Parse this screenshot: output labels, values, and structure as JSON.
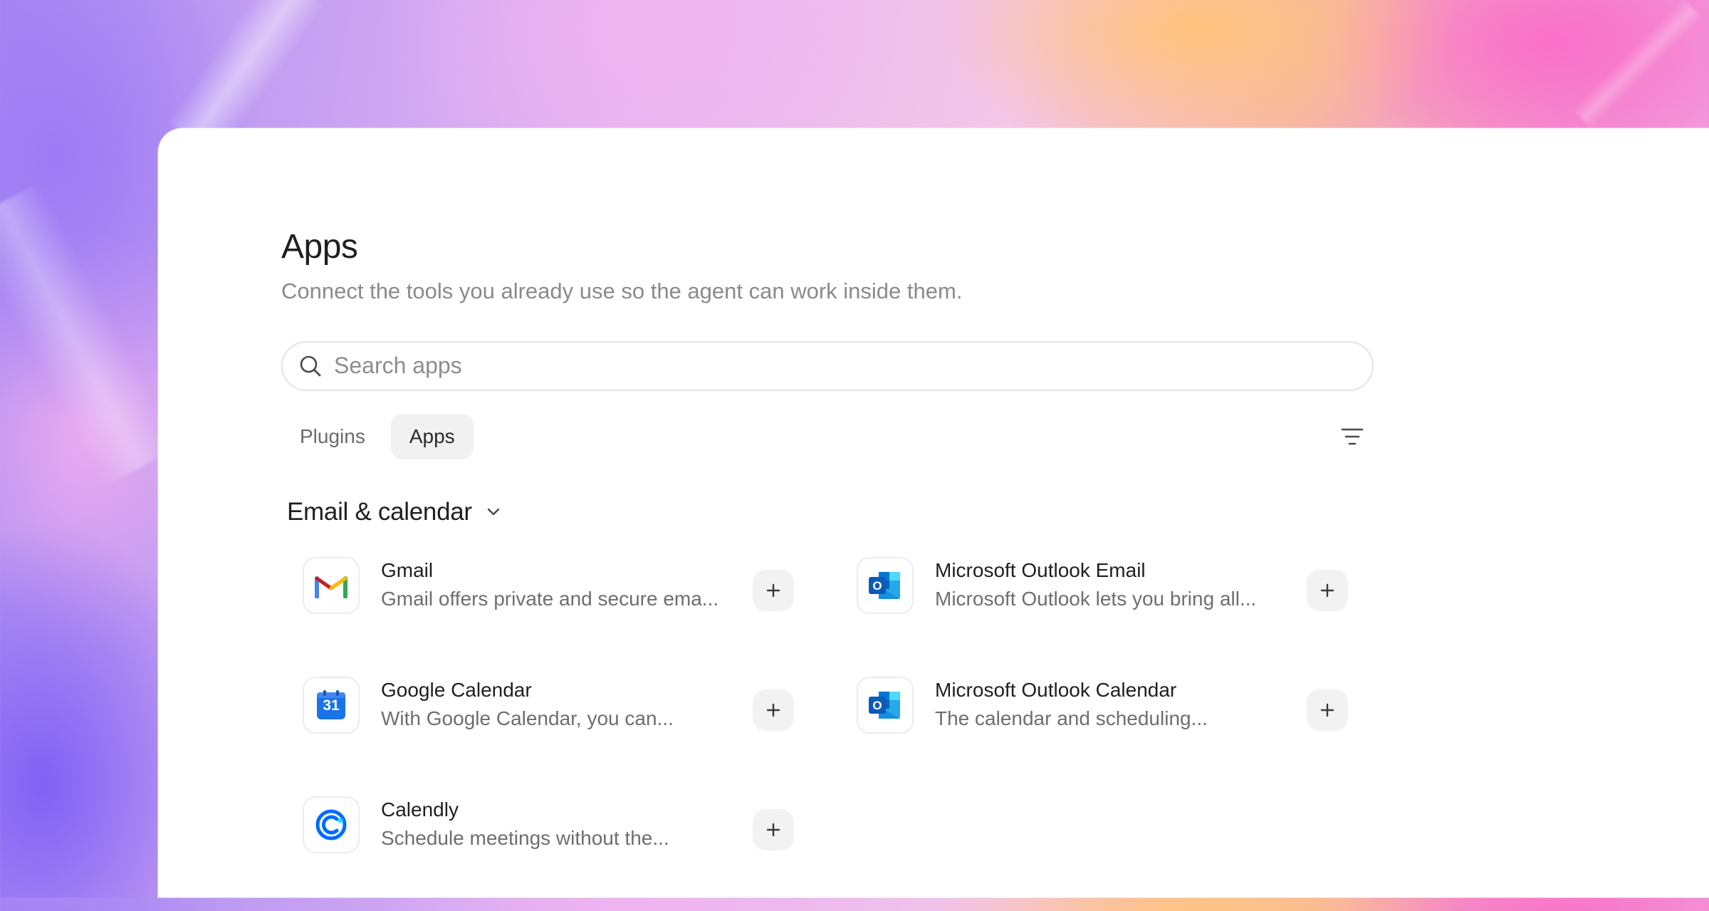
{
  "page": {
    "title": "Apps",
    "subtitle": "Connect the tools you already use so the agent can work inside them."
  },
  "search": {
    "placeholder": "Search apps",
    "value": ""
  },
  "tabs": [
    {
      "label": "Plugins",
      "active": false
    },
    {
      "label": "Apps",
      "active": true
    }
  ],
  "section": {
    "title": "Email & calendar",
    "expanded": true
  },
  "apps": [
    {
      "name": "Gmail",
      "description": "Gmail offers private and secure ema...",
      "icon": "gmail-icon"
    },
    {
      "name": "Microsoft Outlook Email",
      "description": "Microsoft Outlook lets you bring all...",
      "icon": "outlook-icon"
    },
    {
      "name": "Google Calendar",
      "description": "With Google Calendar, you can...",
      "icon": "google-calendar-icon",
      "icon_text": "31"
    },
    {
      "name": "Microsoft Outlook Calendar",
      "description": "The calendar and scheduling...",
      "icon": "outlook-icon"
    },
    {
      "name": "Calendly",
      "description": "Schedule meetings without the...",
      "icon": "calendly-icon"
    }
  ],
  "colors": {
    "text_primary": "#1f1f1f",
    "text_secondary": "#6e6e6e",
    "gmail_red": "#ea4335",
    "google_blue": "#1a73e8",
    "outlook_blue": "#0a64c8",
    "calendly_blue": "#006bff"
  }
}
